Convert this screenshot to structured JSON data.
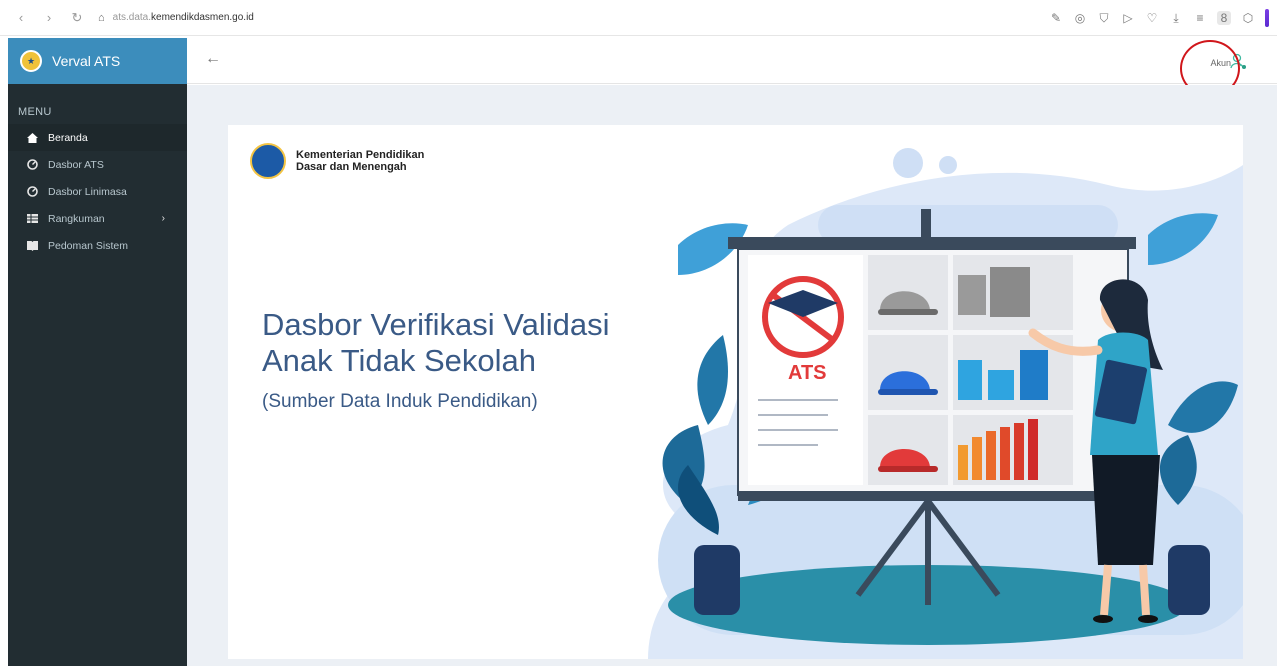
{
  "browser": {
    "url_prefix": "ats.data.",
    "url_domain": "kemendikdasmen.go.id",
    "toolbar_badge": "8"
  },
  "sidebar": {
    "brand_title": "Verval ATS",
    "menu_header": "MENU",
    "items": [
      {
        "label": "Beranda",
        "icon": "home-icon"
      },
      {
        "label": "Dasbor ATS",
        "icon": "dashboard-icon"
      },
      {
        "label": "Dasbor Linimasa",
        "icon": "dashboard-icon"
      },
      {
        "label": "Rangkuman",
        "icon": "table-icon"
      },
      {
        "label": "Pedoman Sistem",
        "icon": "book-icon"
      }
    ]
  },
  "header": {
    "account_label": "Akun"
  },
  "banner": {
    "ministry_line1": "Kementerian Pendidikan",
    "ministry_line2": "Dasar dan Menengah",
    "title_line1": "Dasbor Verifikasi Validasi",
    "title_line2": "Anak Tidak Sekolah",
    "subtitle": "(Sumber Data Induk Pendidikan)",
    "board_label": "ATS"
  },
  "colors": {
    "brand_blue": "#3c8dbc",
    "sidebar_dark": "#222d32",
    "headline": "#3a5a86",
    "annotation_red": "#d0161b"
  }
}
